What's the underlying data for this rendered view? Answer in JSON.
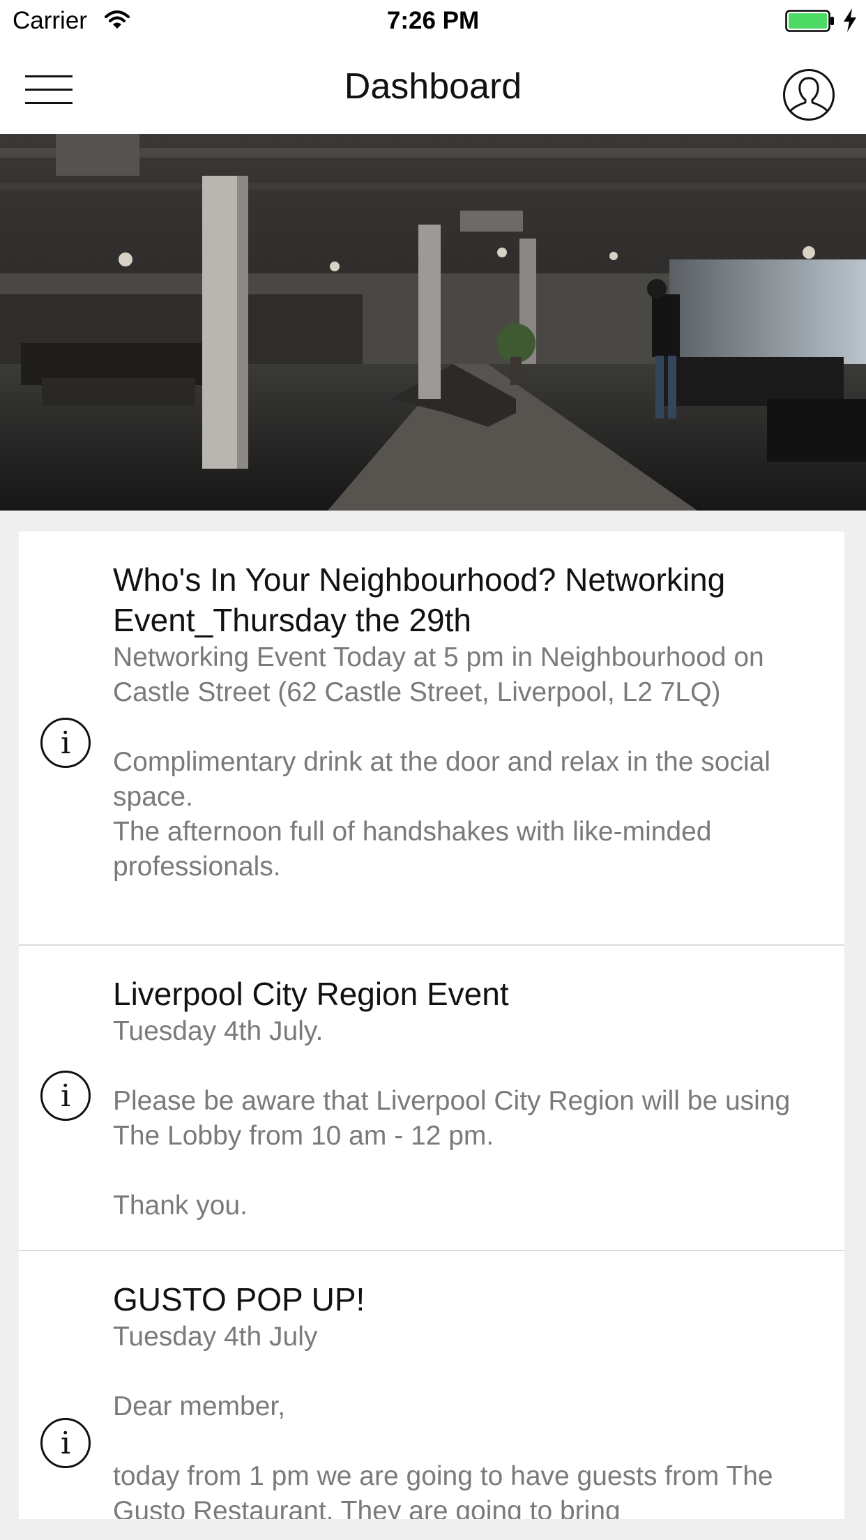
{
  "status_bar": {
    "carrier": "Carrier",
    "time": "7:26 PM",
    "icons": [
      "wifi-icon",
      "battery-icon",
      "charging-bolt-icon"
    ]
  },
  "nav": {
    "title": "Dashboard",
    "left_icon": "menu-icon",
    "right_icon": "profile-icon"
  },
  "hero": {
    "image": "coworking-space-photo"
  },
  "events": [
    {
      "title": "Who's In Your Neighbourhood? Networking Event_Thursday the 29th",
      "body": "Networking Event Today at 5 pm in Neighbourhood on Castle Street (62 Castle Street, Liverpool, L2 7LQ)\n\nComplimentary drink at the door and relax in the social space.\nThe afternoon full of handshakes with like-minded professionals.",
      "icon": "info-icon"
    },
    {
      "title": "Liverpool City Region Event",
      "body": "Tuesday 4th July.\n\nPlease be aware that Liverpool City Region will be using The Lobby from 10 am - 12 pm.\n\nThank you.",
      "icon": "info-icon"
    },
    {
      "title": "GUSTO POP UP!",
      "body": "Tuesday 4th July\n\nDear member,\n\ntoday from 1 pm we are going to have guests from The Gusto Restaurant. They are going to bring",
      "icon": "info-icon"
    }
  ],
  "colors": {
    "background": "#efefef",
    "card": "#ffffff",
    "title_text": "#111111",
    "body_text": "#7a7a7a",
    "battery_fill": "#4cd964"
  }
}
